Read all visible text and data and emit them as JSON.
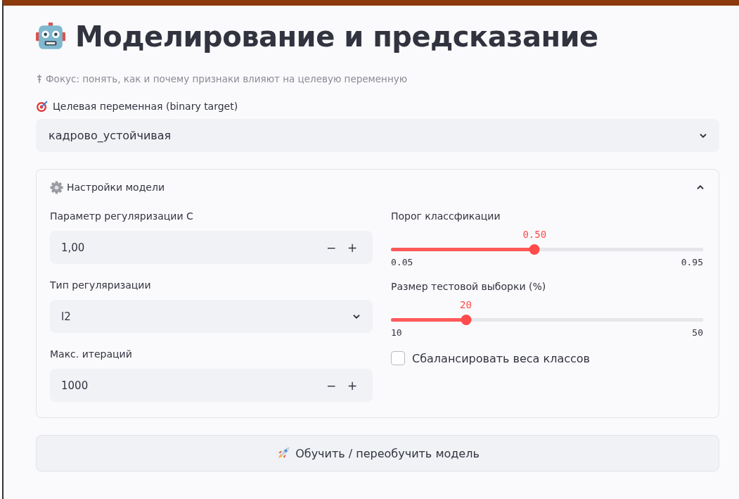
{
  "title": "Моделирование и предсказание",
  "caption": "Фокус: понять, как и почему признаки влияют на целевую переменную",
  "target": {
    "label": "Целевая переменная (binary target)",
    "value": "кадрово_устойчивая"
  },
  "settings": {
    "title": "Настройки модели",
    "expanded": true,
    "left": [
      {
        "kind": "number",
        "label": "Параметр регуляризации C",
        "value": "1,00",
        "minus": "−",
        "plus": "+"
      },
      {
        "kind": "select",
        "label": "Тип регуляризации",
        "value": "l2"
      },
      {
        "kind": "number",
        "label": "Макс. итераций",
        "value": "1000",
        "minus": "−",
        "plus": "+"
      }
    ],
    "right": [
      {
        "kind": "slider",
        "label": "Порог классфикации",
        "reading": "0.50",
        "level": 0.46,
        "min": "0.05",
        "max": "0.95"
      },
      {
        "kind": "slider",
        "label": "Размер тестовой выборки (%)",
        "reading": "20",
        "level": 0.24,
        "min": "10",
        "max": "50"
      },
      {
        "kind": "checkbox",
        "label": "Сбалансировать веса классов",
        "checked": false
      }
    ]
  },
  "train_button": "Обучить / переобучить модель"
}
